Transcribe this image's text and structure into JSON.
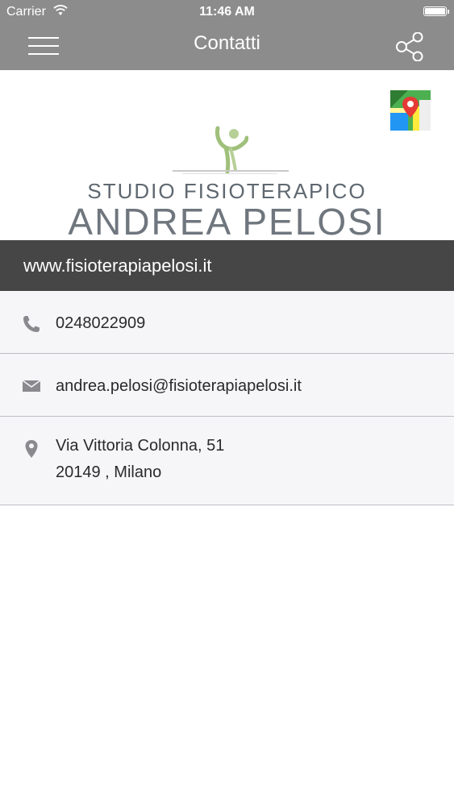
{
  "status_bar": {
    "carrier": "Carrier",
    "time": "11:46 AM"
  },
  "nav": {
    "title": "Contatti",
    "left_icon": "hamburger-menu-icon",
    "right_icon": "share-icon"
  },
  "header": {
    "maps_icon": "maps-icon",
    "logo_line1": "STUDIO FISIOTERAPICO",
    "logo_line2": "ANDREA PELOSI"
  },
  "website": {
    "url": "www.fisioterapiapelosi.it"
  },
  "contacts": [
    {
      "icon": "phone-icon",
      "line1": "0248022909"
    },
    {
      "icon": "email-icon",
      "line1": "andrea.pelosi@fisioterapiapelosi.it"
    },
    {
      "icon": "location-pin-icon",
      "line1": "Via Vittoria Colonna, 51",
      "line2": "20149 , Milano"
    }
  ],
  "colors": {
    "nav_bg": "#8c8c8c",
    "website_bar_bg": "#464646",
    "list_bg": "#f6f6f9",
    "logo_green": "#9fc07a"
  }
}
